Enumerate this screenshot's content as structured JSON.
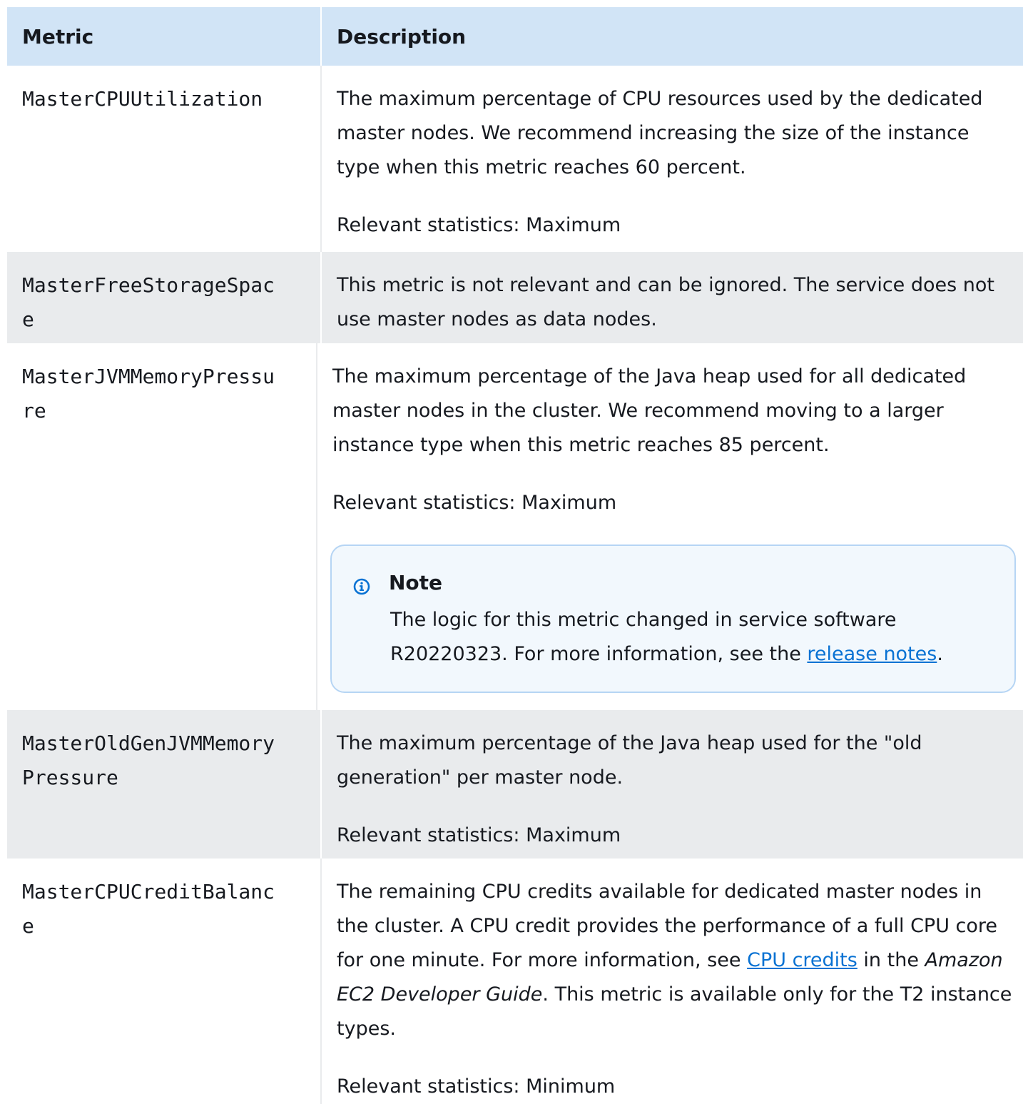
{
  "header": {
    "metric": "Metric",
    "description": "Description"
  },
  "rows": [
    {
      "metric": "MasterCPUUtilization",
      "description": "The maximum percentage of CPU resources used by the dedicated master nodes. We recommend increasing the size of the instance type when this metric reaches 60 percent.",
      "stats": "Relevant statistics: Maximum"
    },
    {
      "metric": "MasterFreeStorageSpace",
      "description": "This metric is not relevant and can be ignored. The service does not use master nodes as data nodes."
    },
    {
      "metric": "MasterJVMMemoryPressure",
      "description": "The maximum percentage of the Java heap used for all dedicated master nodes in the cluster. We recommend moving to a larger instance type when this metric reaches 85 percent.",
      "stats": "Relevant statistics: Maximum",
      "note": {
        "title": "Note",
        "icon": "info-icon",
        "text_before": "The logic for this metric changed in service software R20220323. For more information, see the ",
        "link": "release notes",
        "text_after": "."
      }
    },
    {
      "metric": "MasterOldGenJVMMemoryPressure",
      "description": "The maximum percentage of the Java heap used for the \"old generation\" per master node.",
      "stats": "Relevant statistics: Maximum"
    },
    {
      "metric": "MasterCPUCreditBalance",
      "description_part1": "The remaining CPU credits available for dedicated master nodes in the cluster. A CPU credit provides the performance of a full CPU core for one minute. For more information, see ",
      "description_link": "CPU credits",
      "description_part2": " in the ",
      "description_em": "Amazon EC2 Developer Guide",
      "description_part3": ". This metric is available only for the T2 instance types.",
      "stats": "Relevant statistics: Minimum"
    }
  ],
  "colors": {
    "header_bg": "#d1e4f6",
    "alt_row_bg": "#e9ebed",
    "link": "#0972d3",
    "note_bg": "#f2f8fd",
    "note_border": "#b6d5f4",
    "icon": "#0972d3"
  }
}
